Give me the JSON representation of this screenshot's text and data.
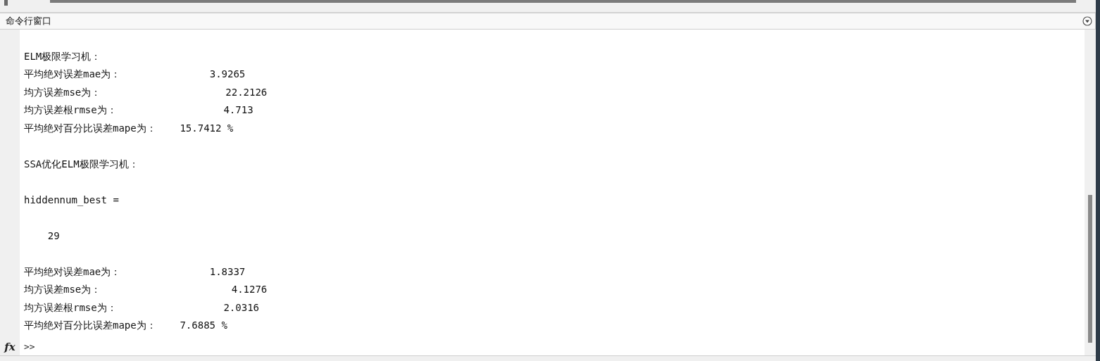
{
  "panel": {
    "title": "命令行窗口"
  },
  "output_blocks": [
    {
      "lines": [
        "ELM极限学习机：",
        "平均绝对误差mae为：               3.9265",
        "均方误差mse为：                     22.2126",
        "均方误差根rmse为：                  4.713",
        "平均绝对百分比误差mape为：    15.7412 %"
      ]
    },
    {
      "lines": [
        "SSA优化ELM极限学习机："
      ]
    },
    {
      "lines": [
        "hiddennum_best ="
      ]
    },
    {
      "lines": [
        "    29"
      ]
    },
    {
      "lines": [
        "平均绝对误差mae为：               1.8337",
        "均方误差mse为：                      4.1276",
        "均方误差根rmse为：                  2.0316",
        "平均绝对百分比误差mape为：    7.6885 %"
      ]
    }
  ],
  "prompt": ">>",
  "function_button": "fx"
}
